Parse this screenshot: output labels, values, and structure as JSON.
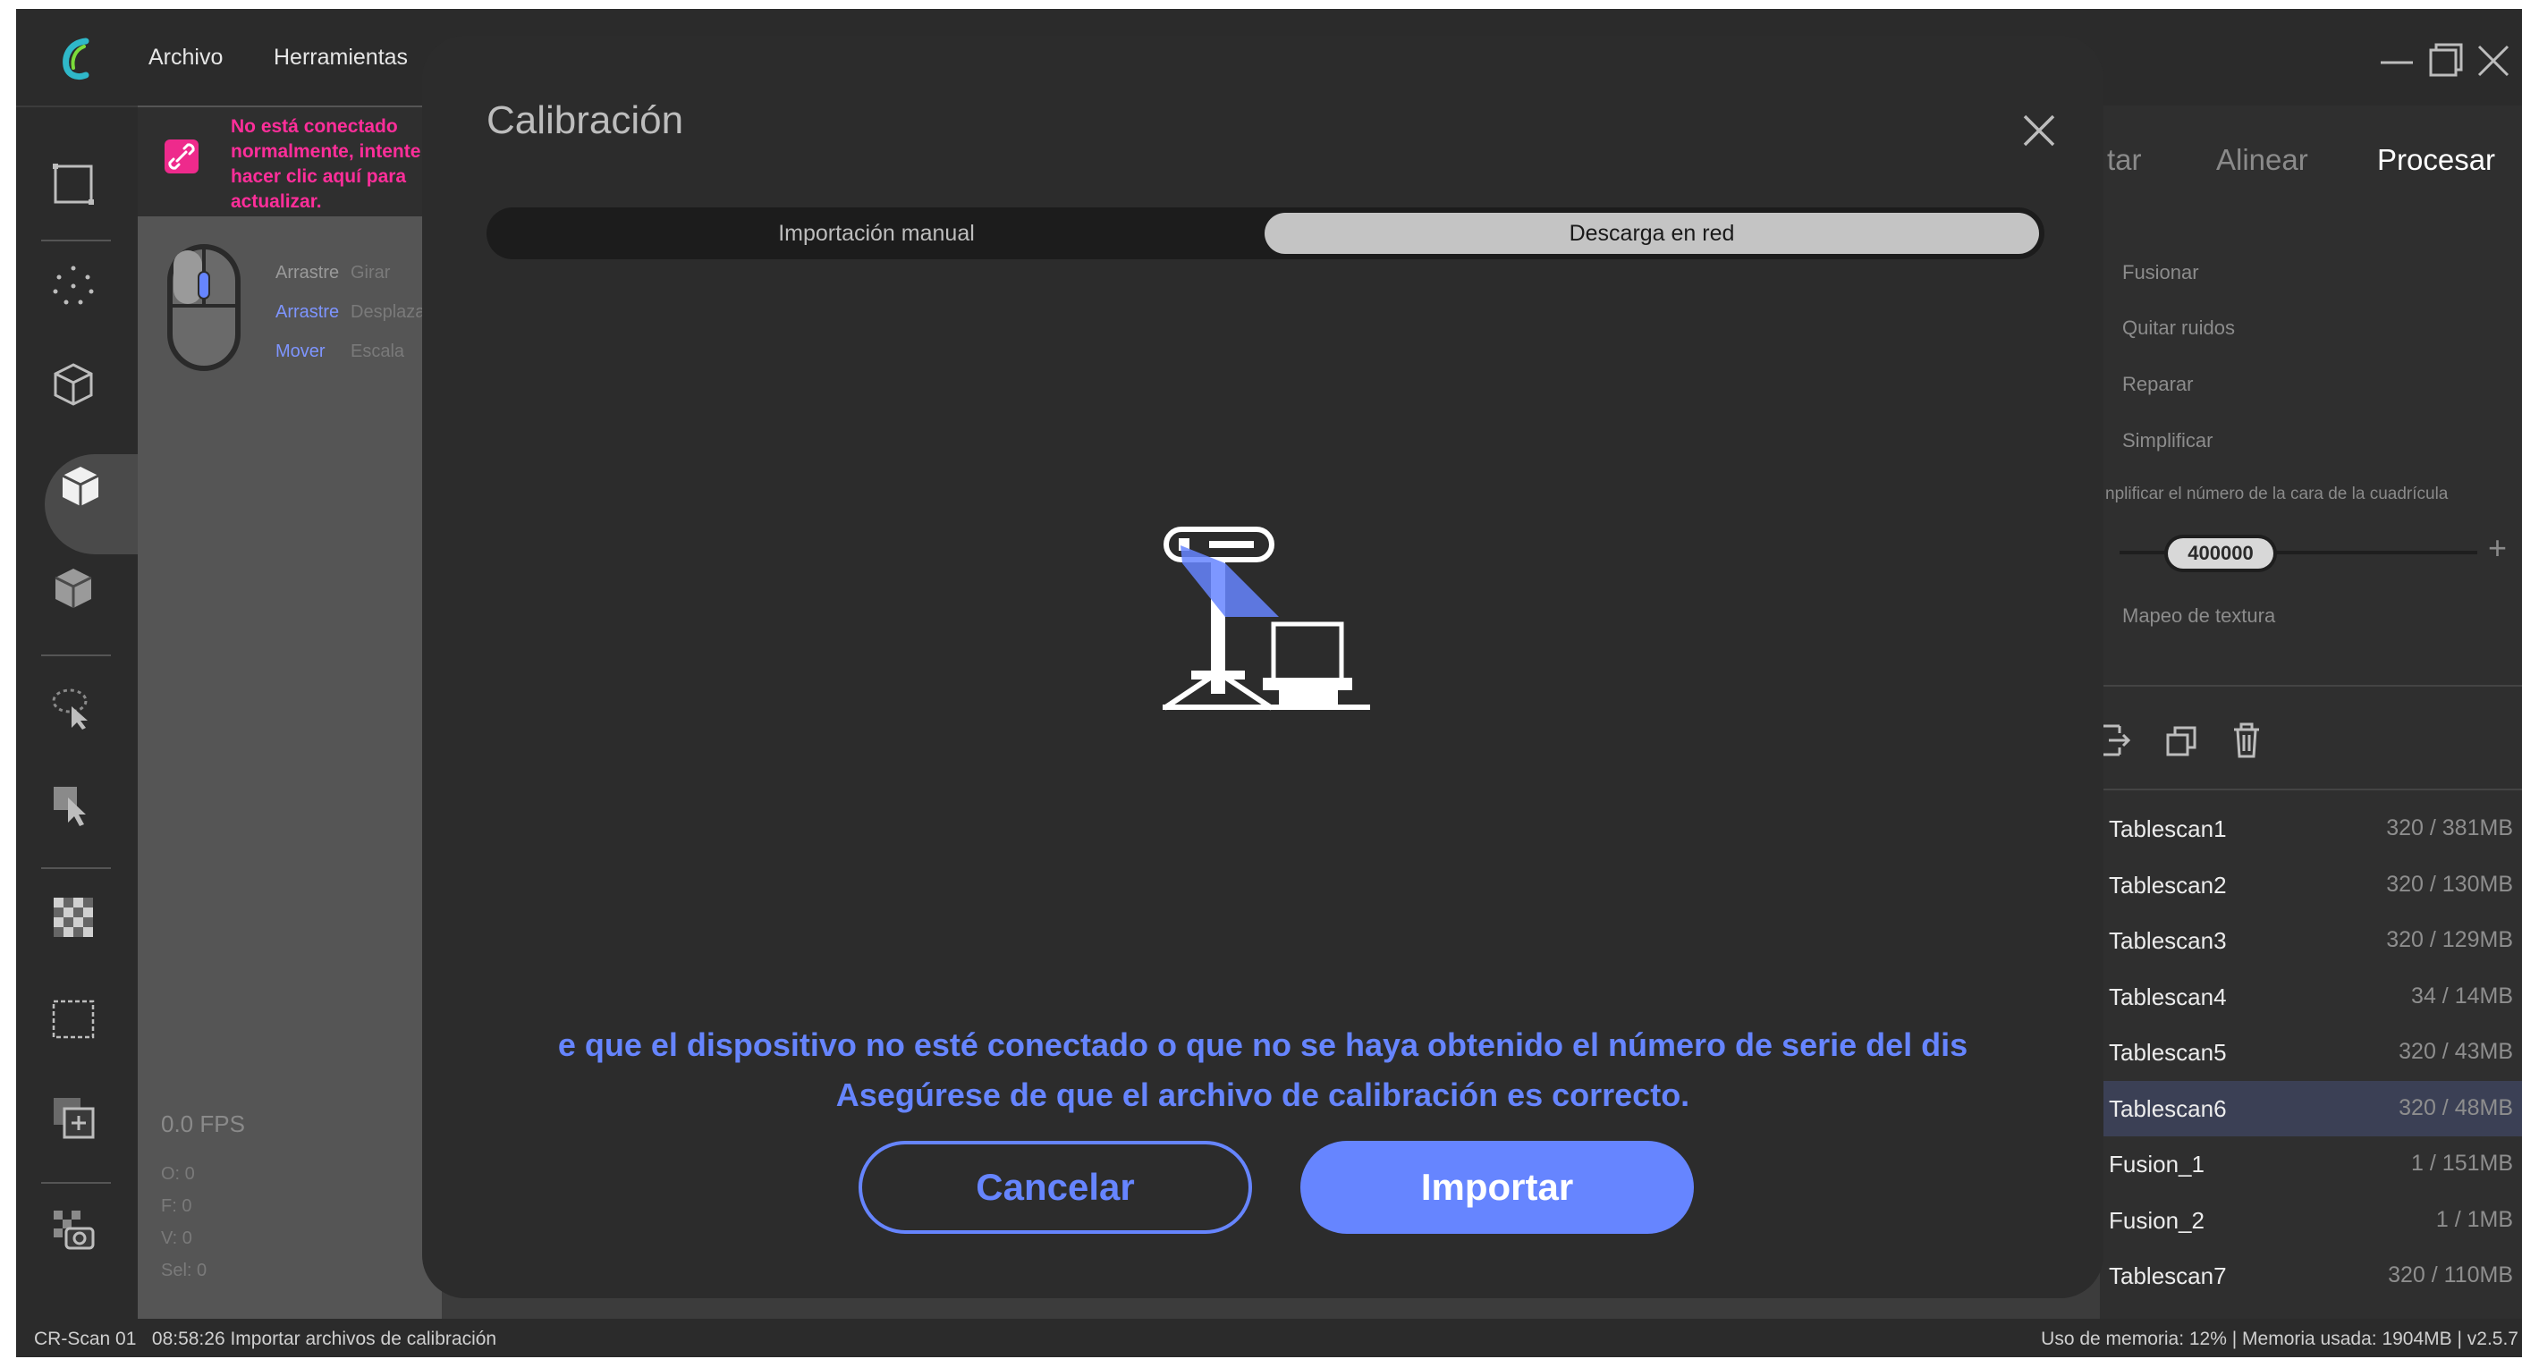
{
  "app": {
    "menu": [
      "Archivo",
      "Herramientas"
    ],
    "window_controls": [
      "minimize-icon",
      "maximize-icon",
      "close-icon"
    ]
  },
  "warning": {
    "text": "No está conectado normalmente, intente hacer clic aquí para actualizar.",
    "icon": "link-broken-icon",
    "color": "#ff2e9a"
  },
  "hints": [
    {
      "action": "Arrastre",
      "effect": "Girar"
    },
    {
      "action": "Arrastre",
      "effect": "Desplazar"
    },
    {
      "action": "Mover",
      "effect": "Escala"
    }
  ],
  "stats": {
    "fps": "0.0 FPS",
    "o": "O: 0",
    "f": "F: 0",
    "v": "V: 0",
    "sel": "Sel: 0"
  },
  "toolbar": [
    "select-rect-icon",
    "point-cloud-icon",
    "mesh-icon",
    "solid-icon",
    "texture-cube-icon",
    "lasso-select-icon",
    "select-through-icon",
    "checker-icon",
    "crop-icon",
    "add-layer-icon",
    "snapshot-icon"
  ],
  "right_panel": {
    "tabs": [
      "tar",
      "Alinear",
      "Procesar"
    ],
    "active_tab": "Procesar",
    "steps": [
      "Fusionar",
      "Quitar ruidos",
      "Reparar",
      "Simplificar"
    ],
    "simplify_label": "nplificar el número de la cara de la cuadrícula",
    "face_count": "400000",
    "plus": "+",
    "texture_label": "Mapeo de textura",
    "files": [
      {
        "name": "Tablescan1",
        "size": "320 / 381MB"
      },
      {
        "name": "Tablescan2",
        "size": "320 / 130MB"
      },
      {
        "name": "Tablescan3",
        "size": "320 / 129MB"
      },
      {
        "name": "Tablescan4",
        "size": "34 / 14MB"
      },
      {
        "name": "Tablescan5",
        "size": "320 / 43MB"
      },
      {
        "name": "Tablescan6",
        "size": "320 / 48MB"
      },
      {
        "name": "Fusion_1",
        "size": "1 / 151MB"
      },
      {
        "name": "Fusion_2",
        "size": "1 / 1MB"
      },
      {
        "name": "Tablescan7",
        "size": "320 / 110MB"
      }
    ],
    "selected_file": "Tablescan6"
  },
  "dialog": {
    "title": "Calibración",
    "tabs": [
      "Importación manual",
      "Descarga en red"
    ],
    "active_tab": "Descarga en red",
    "message_line1": "e que el dispositivo no esté conectado o que no se haya obtenido el número de serie del dis",
    "message_line2": "Asegúrese de que el archivo de calibración es correcto.",
    "cancel_label": "Cancelar",
    "import_label": "Importar",
    "accent": "#6685ff"
  },
  "status": {
    "left": "CR-Scan 01   08:58:26 Importar archivos de calibración",
    "right": "Uso de memoria: 12% | Memoria usada: 1904MB | v2.5.7"
  }
}
